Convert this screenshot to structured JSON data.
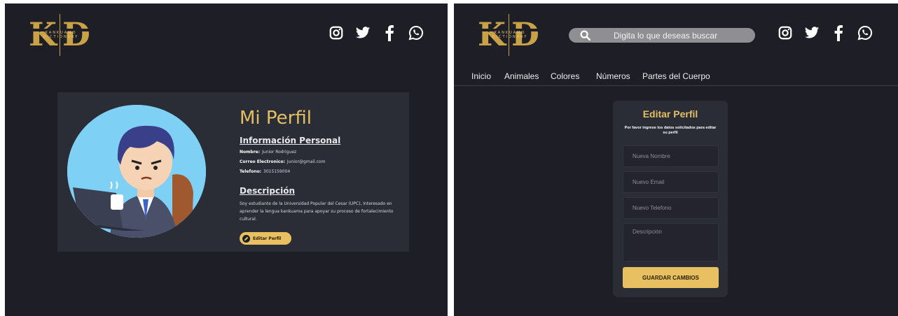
{
  "brand": {
    "logo_letters": "KD",
    "logo_subtitle_line1": "KANKUAMO",
    "logo_subtitle_line2": "DICTIONARY",
    "accent": "#E8C061",
    "background": "#1D1E26",
    "card": "#2A2C36"
  },
  "social_icons": [
    "instagram-icon",
    "twitter-icon",
    "facebook-icon",
    "whatsapp-icon"
  ],
  "profile": {
    "title": "Mi Perfil",
    "personal_heading": "Información Personal",
    "name_label": "Nombre:",
    "name_value": "Junior Rodriguez",
    "email_label": "Correo Electronico:",
    "email_value": "Junior@gmail.com",
    "phone_label": "Telefono:",
    "phone_value": "3015159004",
    "description_heading": "Descripción",
    "description_text": "Soy estudiante de la Universidad Popular del Cesar (UPC), Interesado en aprender la lengua kankuama para apoyar su proceso de fortalecimiento cultural.",
    "edit_button": "Editar Perfil"
  },
  "search": {
    "placeholder": "Digita lo que deseas buscar"
  },
  "nav": {
    "items": [
      "Inicio",
      "Animales",
      "Colores",
      "Números",
      "Partes del Cuerpo"
    ]
  },
  "edit_form": {
    "title": "Editar Perfil",
    "subtitle": "Por favor ingrese los datos solicitados para editar su perfil",
    "name_placeholder": "Nueva Nombre",
    "email_placeholder": "Nuevo Email",
    "phone_placeholder": "Nuevo Telefono",
    "description_placeholder": "Descripción",
    "save_button": "GUARDAR CAMBIOS"
  }
}
